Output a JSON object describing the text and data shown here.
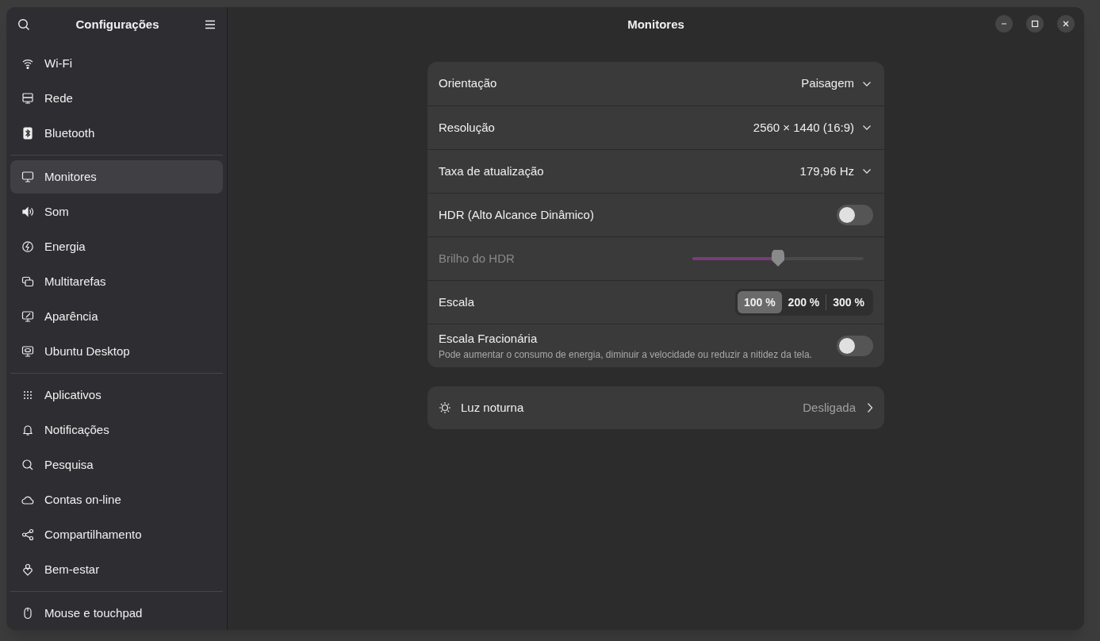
{
  "sidebar": {
    "title": "Configurações",
    "groups": [
      {
        "items": [
          {
            "label": "Wi-Fi",
            "selected": false
          },
          {
            "label": "Rede",
            "selected": false
          },
          {
            "label": "Bluetooth",
            "selected": false
          }
        ]
      },
      {
        "items": [
          {
            "label": "Monitores",
            "selected": true
          },
          {
            "label": "Som",
            "selected": false
          },
          {
            "label": "Energia",
            "selected": false
          },
          {
            "label": "Multitarefas",
            "selected": false
          },
          {
            "label": "Aparência",
            "selected": false
          },
          {
            "label": "Ubuntu Desktop",
            "selected": false
          }
        ]
      },
      {
        "items": [
          {
            "label": "Aplicativos",
            "selected": false
          },
          {
            "label": "Notificações",
            "selected": false
          },
          {
            "label": "Pesquisa",
            "selected": false
          },
          {
            "label": "Contas on-line",
            "selected": false
          },
          {
            "label": "Compartilhamento",
            "selected": false
          },
          {
            "label": "Bem-estar",
            "selected": false
          }
        ]
      },
      {
        "items": [
          {
            "label": "Mouse e touchpad",
            "selected": false
          }
        ]
      }
    ]
  },
  "window": {
    "title": "Monitores"
  },
  "settings": [
    {
      "kind": "dropdown",
      "label": "Orientação",
      "value": "Paisagem"
    },
    {
      "kind": "dropdown",
      "label": "Resolução",
      "value": "2560 × 1440 (16:9)"
    },
    {
      "kind": "dropdown",
      "label": "Taxa de atualização",
      "value": "179,96 Hz"
    },
    {
      "kind": "toggle",
      "label": "HDR (Alto Alcance Dinâmico)",
      "on": false
    },
    {
      "kind": "slider",
      "label": "Brilho do HDR",
      "level": 0.5,
      "disabled": true
    },
    {
      "kind": "segmented",
      "label": "Escala",
      "options": [
        {
          "label": "100 %",
          "selected": true
        },
        {
          "label": "200 %",
          "selected": false
        },
        {
          "label": "300 %",
          "selected": false
        }
      ]
    },
    {
      "kind": "toggle",
      "label": "Escala Fracionária",
      "subtitle": "Pode aumentar o consumo de energia, diminuir a velocidade ou reduzir a nitidez da tela.",
      "on": false
    }
  ],
  "night_light": {
    "label": "Luz noturna",
    "value": "Desligada"
  }
}
